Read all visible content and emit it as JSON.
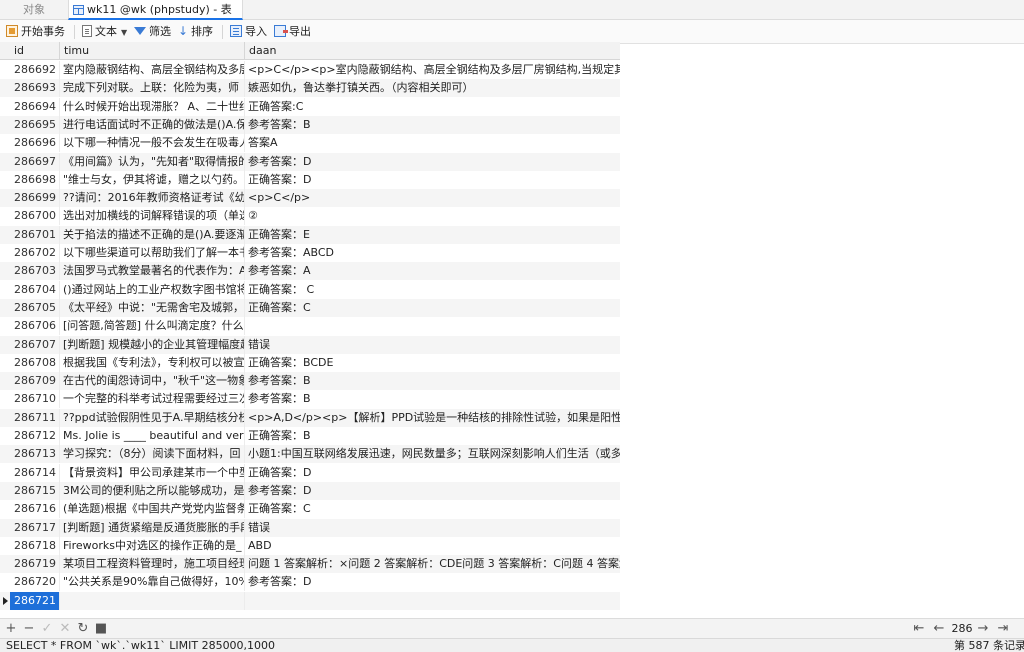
{
  "tabs": [
    {
      "label": "对象"
    },
    {
      "label": "wk11 @wk (phpstudy) - 表"
    }
  ],
  "toolbar": {
    "begin_transaction": "开始事务",
    "text": "文本",
    "filter": "筛选",
    "sort": "排序",
    "import": "导入",
    "export": "导出"
  },
  "columns": [
    "id",
    "timu",
    "daan"
  ],
  "rows": [
    {
      "id": "286692",
      "timu": "室内隐蔽钢结构、高层全钢结构及多层厂房钢结构",
      "daan": "<p>C</p><p>室内隐蔽钢结构、高层全钢结构及多层厂房钢结构,当规定其耐"
    },
    {
      "id": "286693",
      "timu": "完成下列对联。上联：化险为夷，师",
      "daan": "嫉恶如仇，鲁达拳打镇关西。（内容相关即可）"
    },
    {
      "id": "286694",
      "timu": "什么时候开始出现滞胀？ A、二十世纪",
      "daan": "正确答案:C"
    },
    {
      "id": "286695",
      "timu": "进行电话面试时不正确的做法是()A.保",
      "daan": "参考答案：B"
    },
    {
      "id": "286696",
      "timu": "以下哪一种情况一般不会发生在吸毒人",
      "daan": "答案A"
    },
    {
      "id": "286697",
      "timu": "《用间篇》认为，\"先知者\"取得情报的",
      "daan": "参考答案：D"
    },
    {
      "id": "286698",
      "timu": "\"维士与女，伊其将谑，赠之以勺药。\"",
      "daan": "正确答案：D"
    },
    {
      "id": "286699",
      "timu": "??请问：2016年教师资格证考试《幼",
      "daan": "<p>C</p>"
    },
    {
      "id": "286700",
      "timu": "选出对加横线的词解释错误的项（单选",
      "daan": "②"
    },
    {
      "id": "286701",
      "timu": "关于掐法的描述不正确的是()A.要逐渐",
      "daan": "正确答案：E"
    },
    {
      "id": "286702",
      "timu": "以下哪些渠道可以帮助我们了解一本书",
      "daan": "参考答案：ABCD"
    },
    {
      "id": "286703",
      "timu": "法国罗马式教堂最著名的代表作为：A",
      "daan": "参考答案：A"
    },
    {
      "id": "286704",
      "timu": "()通过网站上的工业产权数字图书馆将",
      "daan": "正确答案： C"
    },
    {
      "id": "286705",
      "timu": "《太平经》中说：\"无需舍宅及城郭，",
      "daan": "正确答案：C"
    },
    {
      "id": "286706",
      "timu": "[问答题,简答题] 什么叫滴定度？什么是",
      "daan": ""
    },
    {
      "id": "286707",
      "timu": "[判断题] 规模越小的企业其管理幅度越",
      "daan": "错误"
    },
    {
      "id": "286708",
      "timu": "根据我国《专利法》，专利权可以被宣",
      "daan": "正确答案：BCDE"
    },
    {
      "id": "286709",
      "timu": "在古代的闺怨诗词中，\"秋千\"这一物象",
      "daan": "参考答案：B"
    },
    {
      "id": "286710",
      "timu": "一个完整的科举考试过程需要经过三次",
      "daan": "参考答案：B"
    },
    {
      "id": "286711",
      "timu": "??ppd试验假阴性见于A.早期结核分枝",
      "daan": "<p>A,D</p><p>【解析】PPD试验是一种结核的排除性试验，如果是阳性的"
    },
    {
      "id": "286712",
      "timu": "Ms. Jolie is ____ beautiful and very",
      "daan": "正确答案：B"
    },
    {
      "id": "286713",
      "timu": "学习探究：（8分）阅读下面材料，回",
      "daan": "小题1:中国互联网络发展迅速，网民数量多；互联网深刻影响人们生活（或多"
    },
    {
      "id": "286714",
      "timu": "【背景资料】甲公司承建某市一个中型",
      "daan": "正确答案：D"
    },
    {
      "id": "286715",
      "timu": "3M公司的便利贴之所以能够成功，是",
      "daan": "参考答案：D"
    },
    {
      "id": "286716",
      "timu": "(单选题)根据《中国共产党党内监督条",
      "daan": "正确答案：C"
    },
    {
      "id": "286717",
      "timu": "[判断题] 通货紧缩是反通货膨胀的手段",
      "daan": "错误"
    },
    {
      "id": "286718",
      "timu": "Fireworks中对选区的操作正确的是_",
      "daan": "ABD"
    },
    {
      "id": "286719",
      "timu": "某项目工程资料管理时，施工项目经理",
      "daan": "问题 1 答案解析：×问题 2 答案解析：CDE问题 3 答案解析：C问题 4 答案解"
    },
    {
      "id": "286720",
      "timu": "\"公共关系是90%靠自己做得好，10%",
      "daan": "参考答案：D"
    },
    {
      "id": "286721",
      "timu": "",
      "daan": ""
    }
  ],
  "pagination": {
    "page": "286"
  },
  "status": {
    "sql": "SELECT * FROM `wk`.`wk11` LIMIT 285000,1000",
    "record_count": "第 587 条记录"
  },
  "colors": {
    "selection": "#1e6fd9",
    "accent": "#1a73e8"
  }
}
